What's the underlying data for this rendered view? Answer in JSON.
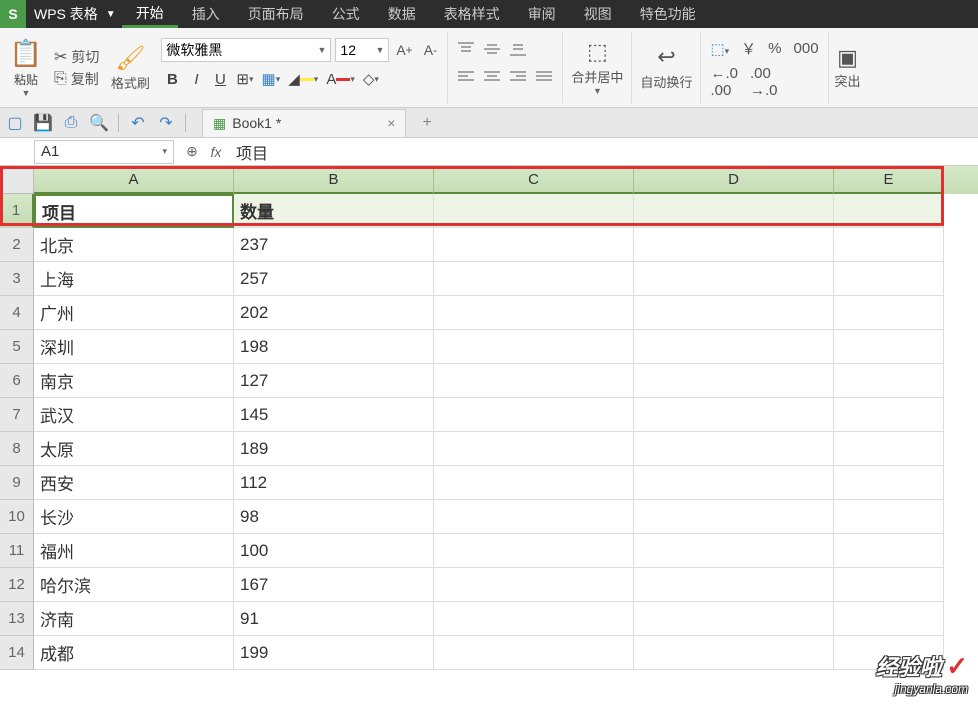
{
  "app": {
    "logo": "S",
    "name": "WPS 表格",
    "menus": [
      "开始",
      "插入",
      "页面布局",
      "公式",
      "数据",
      "表格样式",
      "审阅",
      "视图",
      "特色功能"
    ],
    "active_menu_index": 0
  },
  "ribbon": {
    "paste_label": "粘贴",
    "cut_label": "剪切",
    "copy_label": "复制",
    "format_painter_label": "格式刷",
    "font_name": "微软雅黑",
    "font_size": "12",
    "bold": "B",
    "italic": "I",
    "underline": "U",
    "merge_label": "合并居中",
    "wrap_label": "自动换行",
    "currency_symbol": "￥",
    "percent_symbol": "%",
    "thousand_symbol": ",",
    "dec_inc": ".0",
    "dec_dec": ".00",
    "overflow_label": "突出"
  },
  "qat": {
    "doc_tab": "Book1 *"
  },
  "formula_bar": {
    "name_box": "A1",
    "fx_label": "fx",
    "value": "项目"
  },
  "sheet": {
    "columns": [
      "A",
      "B",
      "C",
      "D",
      "E"
    ],
    "selected_row": 1,
    "active_cell": "A1",
    "rows": [
      {
        "num": 1,
        "A": "项目",
        "B": "数量"
      },
      {
        "num": 2,
        "A": "北京",
        "B": "237"
      },
      {
        "num": 3,
        "A": "上海",
        "B": "257"
      },
      {
        "num": 4,
        "A": "广州",
        "B": "202"
      },
      {
        "num": 5,
        "A": "深圳",
        "B": "198"
      },
      {
        "num": 6,
        "A": "南京",
        "B": "127"
      },
      {
        "num": 7,
        "A": "武汉",
        "B": "145"
      },
      {
        "num": 8,
        "A": "太原",
        "B": "189"
      },
      {
        "num": 9,
        "A": "西安",
        "B": "112"
      },
      {
        "num": 10,
        "A": "长沙",
        "B": "98"
      },
      {
        "num": 11,
        "A": "福州",
        "B": "100"
      },
      {
        "num": 12,
        "A": "哈尔滨",
        "B": "167"
      },
      {
        "num": 13,
        "A": "济南",
        "B": "91"
      },
      {
        "num": 14,
        "A": "成都",
        "B": "199"
      }
    ]
  },
  "watermark": {
    "main": "经验啦",
    "sub": "jingyanla.com"
  }
}
